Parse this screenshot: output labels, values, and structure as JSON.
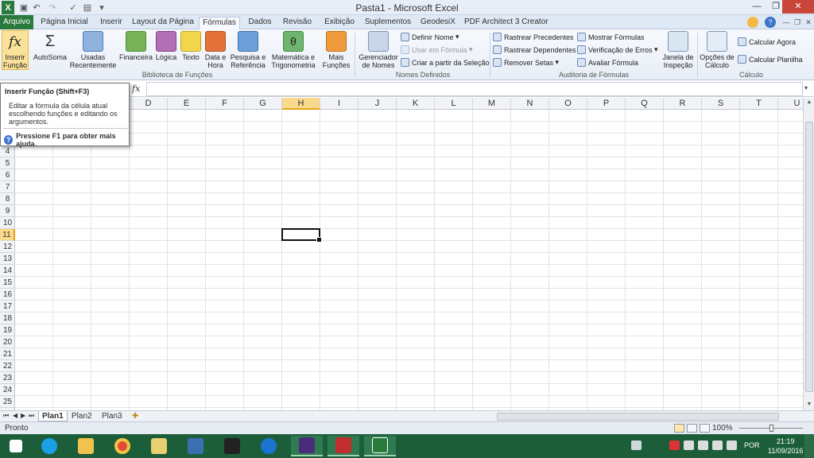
{
  "window": {
    "title": "Pasta1 - Microsoft Excel"
  },
  "quick_access": {
    "icons": [
      "excel-app-icon",
      "save-icon",
      "undo-icon",
      "redo-icon",
      "spellcheck-icon",
      "chart-icon",
      "customize-icon"
    ]
  },
  "window_controls": {
    "minimize": "—",
    "restore": "❐",
    "close": "✕"
  },
  "tabs": [
    "Arquivo",
    "Página Inicial",
    "Inserir",
    "Layout da Página",
    "Fórmulas",
    "Dados",
    "Revisão",
    "Exibição",
    "Suplementos",
    "GeodesiX",
    "PDF Architect 3 Creator"
  ],
  "ribbon": {
    "biblioteca": {
      "group_name": "Biblioteca de Funções",
      "inserir_funcao": "Inserir Função",
      "autosoma": "AutoSoma",
      "usadas": "Usadas Recentemente",
      "financeira": "Financeira",
      "logica": "Lógica",
      "texto": "Texto",
      "data_hora": "Data e Hora",
      "pesquisa": "Pesquisa e Referência",
      "matematica": "Matemática e Trigonometria",
      "mais": "Mais Funções"
    },
    "nomes": {
      "group_name": "Nomes Definidos",
      "gerenciador": "Gerenciador de Nomes",
      "definir": "Definir Nome",
      "usar": "Usar em Fórmula",
      "criar": "Criar a partir da Seleção"
    },
    "auditoria": {
      "group_name": "Auditoria de Fórmulas",
      "precedentes": "Rastrear Precedentes",
      "dependentes": "Rastrear Dependentes",
      "remover": "Remover Setas",
      "mostrar": "Mostrar Fórmulas",
      "verificacao": "Verificação de Erros",
      "avaliar": "Avaliar Fórmula",
      "janela": "Janela de Inspeção"
    },
    "calculo": {
      "group_name": "Cálculo",
      "opcoes": "Opções de Cálculo",
      "agora": "Calcular Agora",
      "planilha": "Calcular Planilha"
    }
  },
  "formula_bar": {
    "fx": "fx",
    "value": ""
  },
  "columns": [
    "D",
    "E",
    "F",
    "G",
    "H",
    "I",
    "J",
    "K",
    "L",
    "M",
    "N",
    "O",
    "P",
    "Q",
    "R",
    "S",
    "T",
    "U"
  ],
  "selected_column": "H",
  "rows": [
    "4",
    "5",
    "6",
    "7",
    "8",
    "9",
    "10",
    "11",
    "12",
    "13",
    "14",
    "15",
    "16",
    "17",
    "18",
    "19",
    "20",
    "21",
    "22",
    "23",
    "24",
    "25"
  ],
  "selected_row": "11",
  "tooltip": {
    "title": "Inserir Função (Shift+F3)",
    "body": "Editar a fórmula da célula atual escolhendo funções e editando os argumentos.",
    "help": "Pressione F1 para obter mais ajuda."
  },
  "sheets": [
    "Plan1",
    "Plan2",
    "Plan3"
  ],
  "active_sheet": "Plan1",
  "status": {
    "text": "Pronto",
    "zoom": "100%"
  },
  "taskbar": {
    "apps": [
      "windows-start-icon",
      "skype-icon",
      "file-explorer-icon",
      "chrome-icon",
      "folder-icon",
      "virtualbox-icon",
      "inkscape-icon",
      "teamviewer-icon",
      "texmaker-icon",
      "pdf-architect-icon",
      "excel-icon"
    ],
    "language": "POR",
    "time": "21:19",
    "date": "11/09/2016"
  },
  "colors": {
    "excel_green": "#2a7a3b",
    "selection_header": "#f9d98b",
    "taskbar": "#1d5e3a"
  }
}
